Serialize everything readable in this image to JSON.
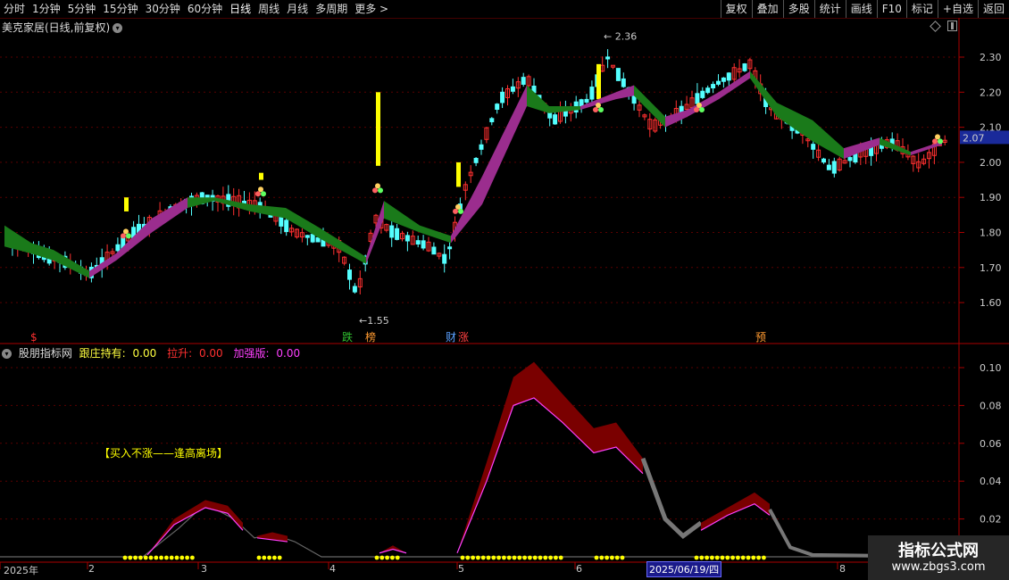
{
  "toolbar": {
    "periods": [
      "分时",
      "1分钟",
      "5分钟",
      "15分钟",
      "30分钟",
      "60分钟",
      "日线",
      "周线",
      "月线",
      "多周期",
      "更多 >"
    ],
    "active_period": "日线",
    "right_buttons": [
      "复权",
      "叠加",
      "多股",
      "统计",
      "画线",
      "F10",
      "标记",
      "+自选",
      "返回"
    ]
  },
  "stock": {
    "title": "美克家居(日线,前复权)"
  },
  "price_chart": {
    "y_ticks": [
      "2.30",
      "2.20",
      "2.10",
      "2.00",
      "1.90",
      "1.80",
      "1.70",
      "1.60"
    ],
    "current_price": "2.07",
    "high_label": "2.36",
    "low_label": "1.55",
    "bottom_tags": [
      {
        "text": "$",
        "color": "#ff3030"
      },
      {
        "text": "跌",
        "color": "#30c030"
      },
      {
        "text": "榜",
        "color": "#ff9a30"
      },
      {
        "text": "财",
        "color": "#5aa0ff"
      },
      {
        "text": "涨",
        "color": "#ff4040"
      },
      {
        "text": "预",
        "color": "#ff9a30"
      }
    ]
  },
  "indicator": {
    "name": "股朋指标网",
    "items": [
      {
        "label": "跟庄持有:",
        "value": "0.00",
        "color": "#ffff40"
      },
      {
        "label": "拉升:",
        "value": "0.00",
        "color": "#ff3030"
      },
      {
        "label": "加强版:",
        "value": "0.00",
        "color": "#ff40ff"
      }
    ],
    "annotation": "【买入不涨——逢高离场】",
    "y_ticks": [
      "0.10",
      "0.08",
      "0.06",
      "0.04",
      "0.02"
    ]
  },
  "date_axis": {
    "labels": [
      "2025年",
      "2",
      "3",
      "4",
      "5",
      "6",
      "8"
    ],
    "cursor_date": "2025/06/19/四"
  },
  "watermark": {
    "line1": "指标公式网",
    "line2": "www.zbgs3.com"
  },
  "colors": {
    "up": "#ff3030",
    "down": "#54ffff",
    "ribbon_up": "#9b2d8e",
    "ribbon_down": "#1a7a1a",
    "highlight": "#ffff00"
  }
}
